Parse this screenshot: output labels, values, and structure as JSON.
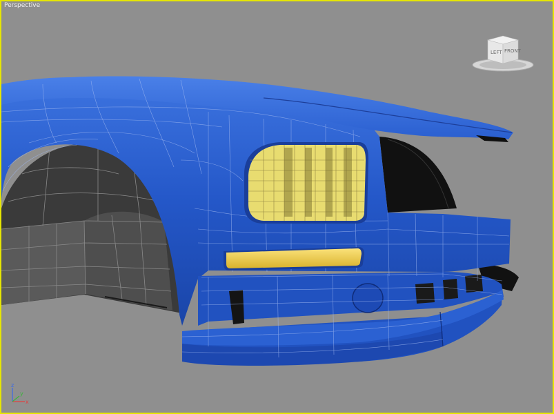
{
  "viewport": {
    "label": "Perspective",
    "active_border_color": "#e6e600",
    "background_color": "#8f8f8f"
  },
  "viewcube": {
    "left_face": "LEFT",
    "front_face": "FRONT"
  },
  "axis_tripod": {
    "x": "x",
    "y": "y",
    "z": "z"
  },
  "scene": {
    "object": "car front fender and bumper mesh",
    "body_color": "#2a5fd0",
    "wireframe_color": "#9fb7ef",
    "headlight_color": "#e8dc70",
    "fog_light_color": "#f2d24a"
  }
}
